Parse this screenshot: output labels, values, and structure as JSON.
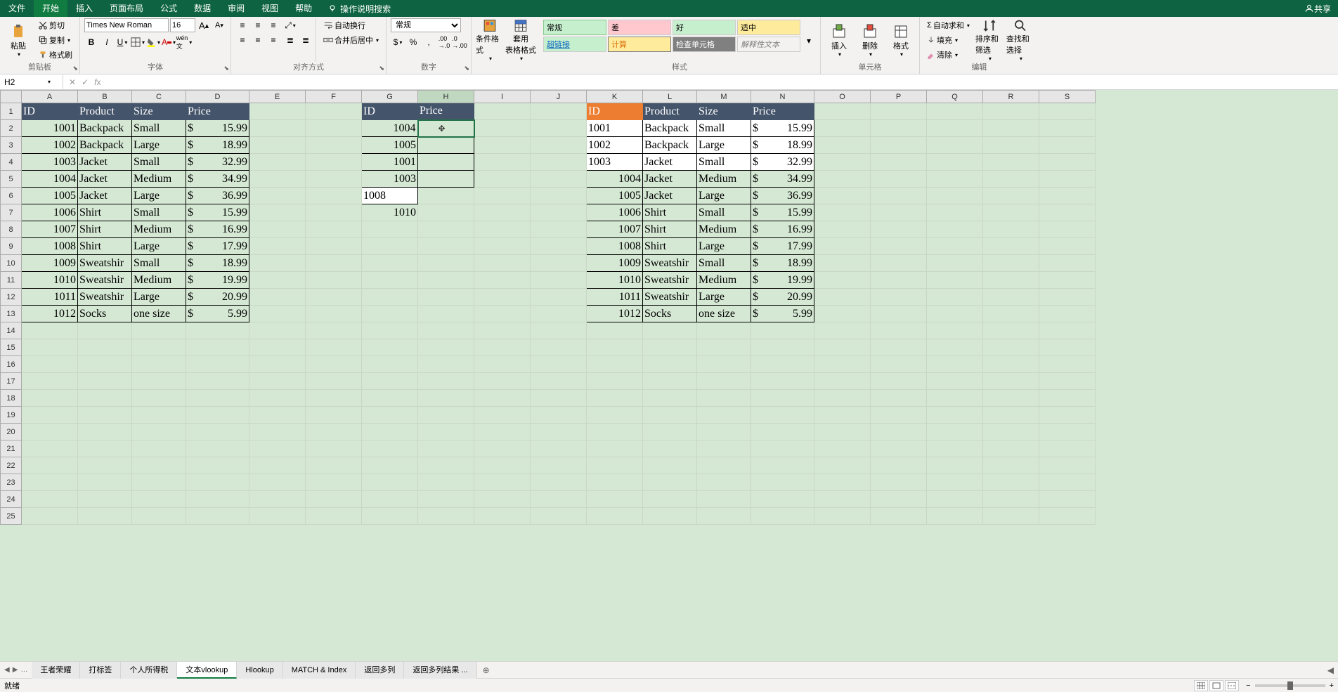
{
  "menu": {
    "items": [
      "文件",
      "开始",
      "插入",
      "页面布局",
      "公式",
      "数据",
      "审阅",
      "视图",
      "帮助"
    ],
    "active": 1,
    "tell_me": "操作说明搜索",
    "share": "共享"
  },
  "ribbon": {
    "clipboard": {
      "paste": "粘贴",
      "cut": "剪切",
      "copy": "复制",
      "format_painter": "格式刷",
      "label": "剪贴板"
    },
    "font": {
      "name": "Times New Roman",
      "size": "16",
      "label": "字体"
    },
    "alignment": {
      "wrap": "自动换行",
      "merge": "合并后居中",
      "label": "对齐方式"
    },
    "number": {
      "general": "常规",
      "label": "数字"
    },
    "cond": {
      "cond_format": "条件格式",
      "table_format": "套用\n表格格式",
      "label": ""
    },
    "styles": {
      "normal": "常规",
      "bad": "差",
      "good": "好",
      "neutral": "适中",
      "hyperlink": "超链接",
      "calc": "计算",
      "check": "检查单元格",
      "explain": "解释性文本",
      "label": "样式"
    },
    "cells": {
      "insert": "插入",
      "delete": "删除",
      "format": "格式",
      "label": "单元格"
    },
    "editing": {
      "sum": "自动求和",
      "fill": "填充",
      "clear": "清除",
      "sort": "排序和筛选",
      "find": "查找和选择",
      "label": "编辑"
    }
  },
  "namebox": "H2",
  "formula": "",
  "columns": [
    "A",
    "B",
    "C",
    "D",
    "E",
    "F",
    "G",
    "H",
    "I",
    "J",
    "K",
    "L",
    "M",
    "N",
    "O",
    "P",
    "Q",
    "R",
    "S"
  ],
  "rows": 25,
  "table1": {
    "headers": [
      "ID",
      "Product",
      "Size",
      "Price"
    ],
    "data": [
      [
        "1001",
        "Backpack",
        "Small",
        "15.99"
      ],
      [
        "1002",
        "Backpack",
        "Large",
        "18.99"
      ],
      [
        "1003",
        "Jacket",
        "Small",
        "32.99"
      ],
      [
        "1004",
        "Jacket",
        "Medium",
        "34.99"
      ],
      [
        "1005",
        "Jacket",
        "Large",
        "36.99"
      ],
      [
        "1006",
        "Shirt",
        "Small",
        "15.99"
      ],
      [
        "1007",
        "Shirt",
        "Medium",
        "16.99"
      ],
      [
        "1008",
        "Shirt",
        "Large",
        "17.99"
      ],
      [
        "1009",
        "Sweatshir",
        "Small",
        "18.99"
      ],
      [
        "1010",
        "Sweatshir",
        "Medium",
        "19.99"
      ],
      [
        "1011",
        "Sweatshir",
        "Large",
        "20.99"
      ],
      [
        "1012",
        "Socks",
        "one size",
        "5.99"
      ]
    ]
  },
  "lookup": {
    "headers": [
      "ID",
      "Price"
    ],
    "ids": [
      "1004",
      "1005",
      "1001",
      "1003",
      "1008",
      "1010"
    ]
  },
  "table2": {
    "orange_header": "ID",
    "headers": [
      "Product",
      "Size",
      "Price"
    ],
    "data": [
      [
        "1001",
        "Backpack",
        "Small",
        "15.99"
      ],
      [
        "1002",
        "Backpack",
        "Large",
        "18.99"
      ],
      [
        "1003",
        "Jacket",
        "Small",
        "32.99"
      ],
      [
        "1004",
        "Jacket",
        "Medium",
        "34.99"
      ],
      [
        "1005",
        "Jacket",
        "Large",
        "36.99"
      ],
      [
        "1006",
        "Shirt",
        "Small",
        "15.99"
      ],
      [
        "1007",
        "Shirt",
        "Medium",
        "16.99"
      ],
      [
        "1008",
        "Shirt",
        "Large",
        "17.99"
      ],
      [
        "1009",
        "Sweatshir",
        "Small",
        "18.99"
      ],
      [
        "1010",
        "Sweatshir",
        "Medium",
        "19.99"
      ],
      [
        "1011",
        "Sweatshir",
        "Large",
        "20.99"
      ],
      [
        "1012",
        "Socks",
        "one size",
        "5.99"
      ]
    ],
    "bordered_first3": true
  },
  "sheet_tabs": {
    "tabs": [
      "王者荣耀",
      "打标签",
      "个人所得税",
      "文本vlookup",
      "Hlookup",
      "MATCH & Index",
      "返回多列",
      "返回多列结果 ..."
    ],
    "active": 3
  },
  "status": {
    "ready": "就绪"
  },
  "currency": "$"
}
